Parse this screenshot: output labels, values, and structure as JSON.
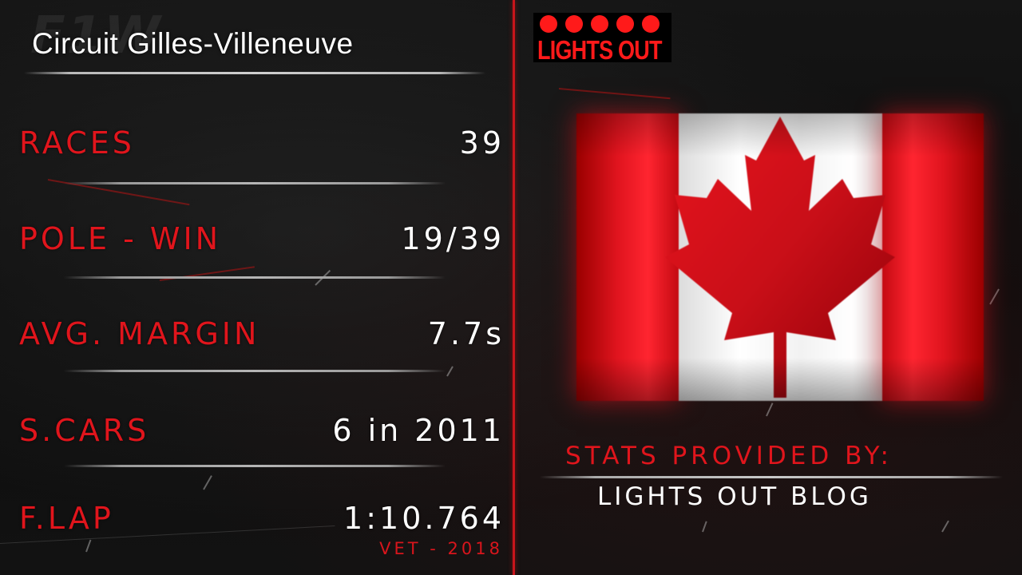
{
  "header": {
    "circuit_name": "Circuit Gilles-Villeneuve",
    "watermark": "F1W"
  },
  "stats": [
    {
      "label": "RACES",
      "value": "39"
    },
    {
      "label": "POLE - WIN",
      "value": "19/39"
    },
    {
      "label": "AVG. MARGIN",
      "value": "7.7s"
    },
    {
      "label": "S.CARS",
      "value": "6 in 2011"
    },
    {
      "label": "F.LAP",
      "value": "1:10.764",
      "sub": "VET - 2018"
    }
  ],
  "logo": {
    "text": "LIGHTS OUT",
    "dot_count": 5,
    "color": "#ff1a1a"
  },
  "flag": {
    "icon": "canada-flag",
    "colors": {
      "red": "#e0141e",
      "white": "#ffffff"
    }
  },
  "credits": {
    "label": "STATS PROVIDED BY:",
    "value": "LIGHTS OUT BLOG"
  },
  "colors": {
    "accent_red": "#e0151c",
    "divider": "#c8151b",
    "text": "#ffffff",
    "background": "#0b0b0b"
  }
}
